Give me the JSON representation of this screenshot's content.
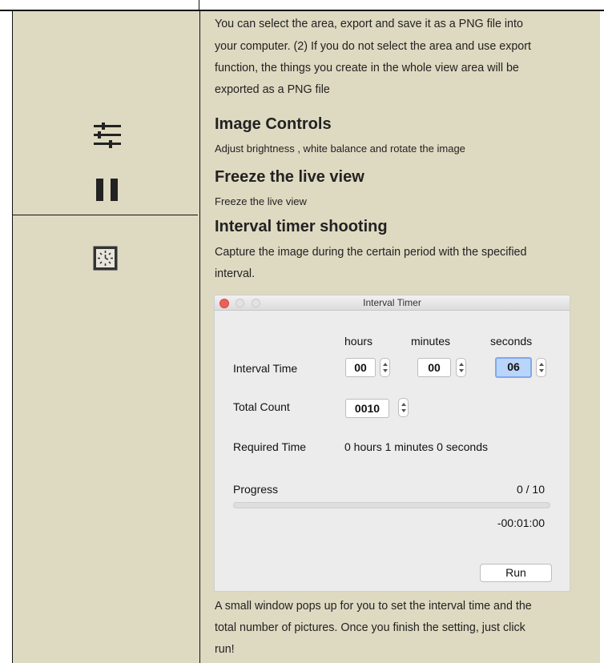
{
  "intro": {
    "line1": "You can select the area, export and save it as a PNG file into",
    "line2": "your computer. (2) If you do not select the area and use export",
    "line3": "function, the things you create in the whole view area will be",
    "line4": "exported as a PNG file"
  },
  "sections": {
    "image_controls": {
      "icon": "sliders-icon",
      "heading": "Image Controls",
      "desc": "Adjust brightness , white balance and rotate the image"
    },
    "freeze": {
      "icon": "pause-icon",
      "heading": "Freeze the live view",
      "desc": "Freeze the live view"
    },
    "interval": {
      "icon": "clock-icon",
      "heading": "Interval timer shooting",
      "desc_line1": "Capture the image during the certain period with the specified",
      "desc_line2": "interval."
    }
  },
  "dialog": {
    "title": "Interval Timer",
    "col_hours": "hours",
    "col_minutes": "minutes",
    "col_seconds": "seconds",
    "interval_label": "Interval Time",
    "hours_value": "00",
    "minutes_value": "00",
    "seconds_value": "06",
    "total_label": "Total Count",
    "total_value": "0010",
    "required_label": "Required Time",
    "required_value": "0 hours 1 minutes 0 seconds",
    "progress_label": "Progress",
    "progress_count": "0 / 10",
    "progress_fraction": 0,
    "remaining": "-00:01:00",
    "run_label": "Run"
  },
  "outro": {
    "line1": "A small window pops up for you to set the interval time and the",
    "line2": "total number of pictures. Once you finish the setting, just click",
    "line3": "run!"
  },
  "colors": {
    "cell_bg": "#ded9c1",
    "close_button": "#ec5f5a",
    "progress": "#4a8ff0"
  }
}
